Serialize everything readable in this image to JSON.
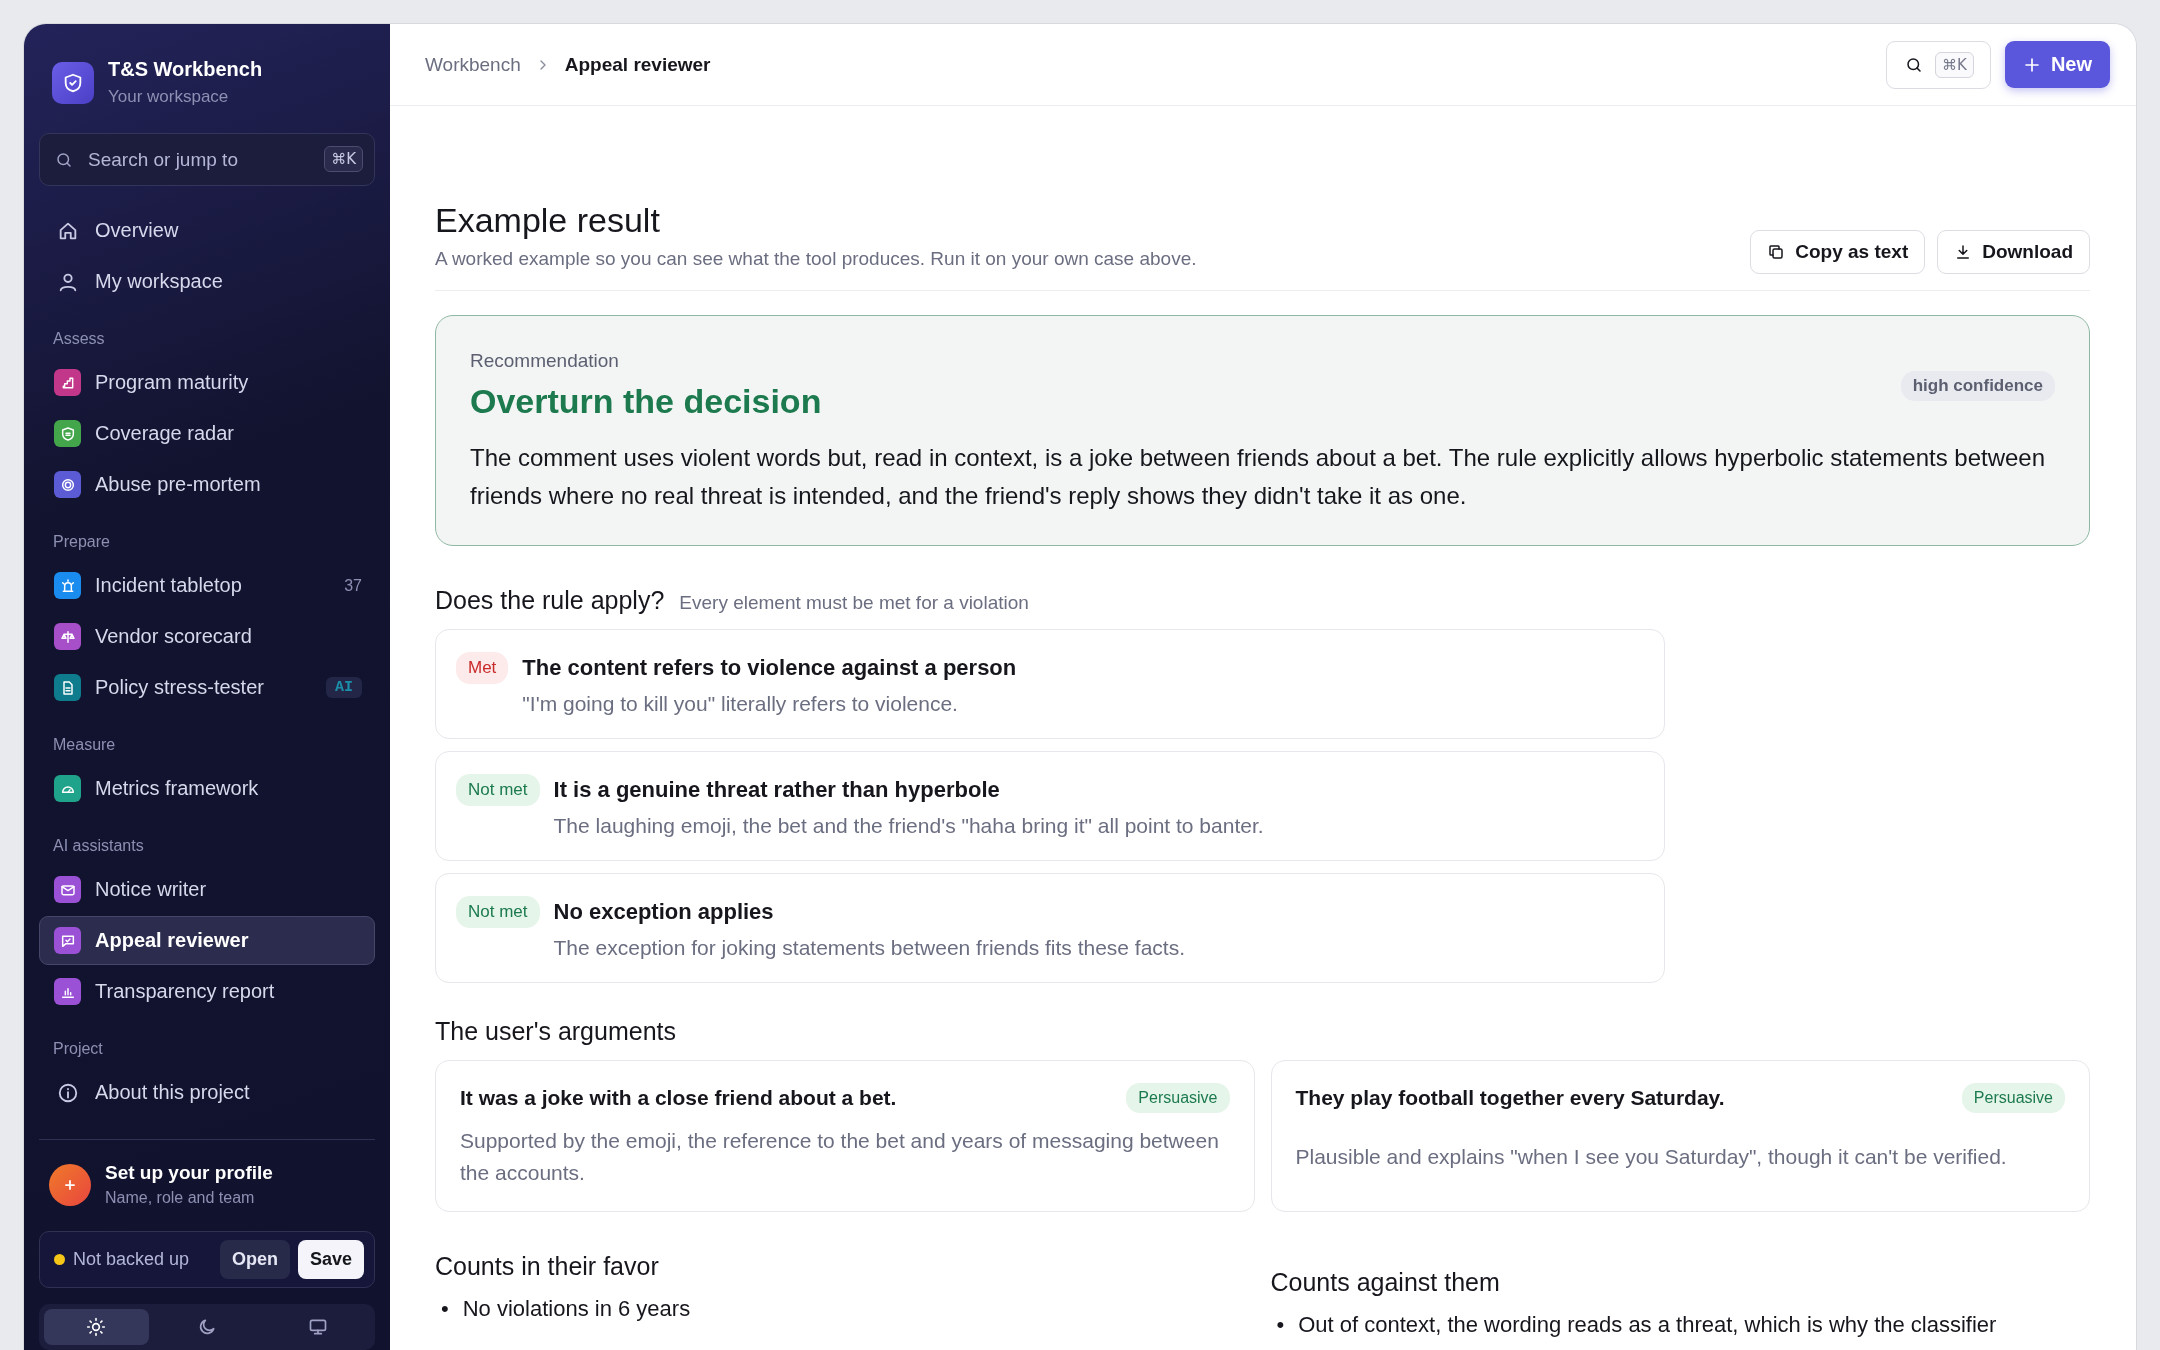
{
  "brand": {
    "title": "T&S Workbench",
    "subtitle": "Your workspace"
  },
  "sidebar_search": {
    "placeholder": "Search or jump to",
    "shortcut": "⌘K"
  },
  "sidebar": {
    "top_items": [
      {
        "label": "Overview",
        "selected": false
      },
      {
        "label": "My workspace",
        "selected": false
      }
    ],
    "sections": [
      {
        "title": "Assess",
        "items": [
          {
            "label": "Program maturity",
            "selected": false,
            "color": "#c2378a"
          },
          {
            "label": "Coverage radar",
            "selected": false,
            "color": "#43a64a"
          },
          {
            "label": "Abuse pre-mortem",
            "selected": false,
            "color": "#5b5bd6"
          }
        ]
      },
      {
        "title": "Prepare",
        "items": [
          {
            "label": "Incident tabletop",
            "selected": false,
            "color": "#1a8cf0",
            "count": "37"
          },
          {
            "label": "Vendor scorecard",
            "selected": false,
            "color": "#a64fc9"
          },
          {
            "label": "Policy stress-tester",
            "selected": false,
            "color": "#0e7c8c",
            "badge": "AI"
          }
        ]
      },
      {
        "title": "Measure",
        "items": [
          {
            "label": "Metrics framework",
            "selected": false,
            "color": "#1fa38a"
          }
        ]
      },
      {
        "title": "AI assistants",
        "items": [
          {
            "label": "Notice writer",
            "selected": false,
            "color": "#9b51d6"
          },
          {
            "label": "Appeal reviewer",
            "selected": true,
            "color": "#9b51d6"
          },
          {
            "label": "Transparency report",
            "selected": false,
            "color": "#9b51d6"
          }
        ]
      },
      {
        "title": "Project",
        "items": [
          {
            "label": "About this project",
            "selected": false
          }
        ]
      }
    ]
  },
  "profile": {
    "title": "Set up your profile",
    "subtitle": "Name, role and team"
  },
  "backup": {
    "status": "Not backed up",
    "backed_up": false,
    "buttons": [
      "Open",
      "Save"
    ]
  },
  "theme_options": [
    {
      "kind": "light",
      "selected": true
    },
    {
      "kind": "dark",
      "selected": false
    },
    {
      "kind": "system",
      "selected": false
    }
  ],
  "breadcrumbs": [
    "Workbench",
    "Appeal reviewer"
  ],
  "header": {
    "shortcut": "⌘K",
    "new_button": "New"
  },
  "result": {
    "title": "Example result",
    "subtitle": "A worked example so you can see what the tool produces. Run it on your own case above.",
    "actions": [
      "Copy as text",
      "Download"
    ]
  },
  "recommendation": {
    "label": "Recommendation",
    "title": "Overturn the decision",
    "confidence": "high confidence",
    "body": "The comment uses violent words but, read in context, is a joke between friends about a bet. The rule explicitly allows hyperbolic statements between friends where no real threat is intended, and the friend's reply shows they didn't take it as one."
  },
  "rule": {
    "title": "Does the rule apply?",
    "subtitle": "Every element must be met for a violation",
    "elements": [
      {
        "status": "Met",
        "met": true,
        "title": "The content refers to violence against a person",
        "detail": "\"I'm going to kill you\" literally refers to violence."
      },
      {
        "status": "Not met",
        "met": false,
        "title": "It is a genuine threat rather than hyperbole",
        "detail": "The laughing emoji, the bet and the friend's \"haha bring it\" all point to banter."
      },
      {
        "status": "Not met",
        "met": false,
        "title": "No exception applies",
        "detail": "The exception for joking statements between friends fits these facts."
      }
    ]
  },
  "arguments": {
    "title": "The user's arguments",
    "items": [
      {
        "claim": "It was a joke with a close friend about a bet.",
        "verdict": "Persuasive",
        "detail": "Supported by the emoji, the reference to the bet and years of messaging between the accounts."
      },
      {
        "claim": "They play football together every Saturday.",
        "verdict": "Persuasive",
        "detail": "Plausible and explains \"when I see you Saturday\", though it can't be verified."
      }
    ]
  },
  "counts": [
    {
      "title": "Counts in their favor",
      "bullet": "•",
      "items": [
        "No violations in 6 years"
      ]
    },
    {
      "title": "Counts against them",
      "bullet": "•",
      "items": [
        "Out of context, the wording reads as a threat, which is why the classifier"
      ]
    }
  ]
}
